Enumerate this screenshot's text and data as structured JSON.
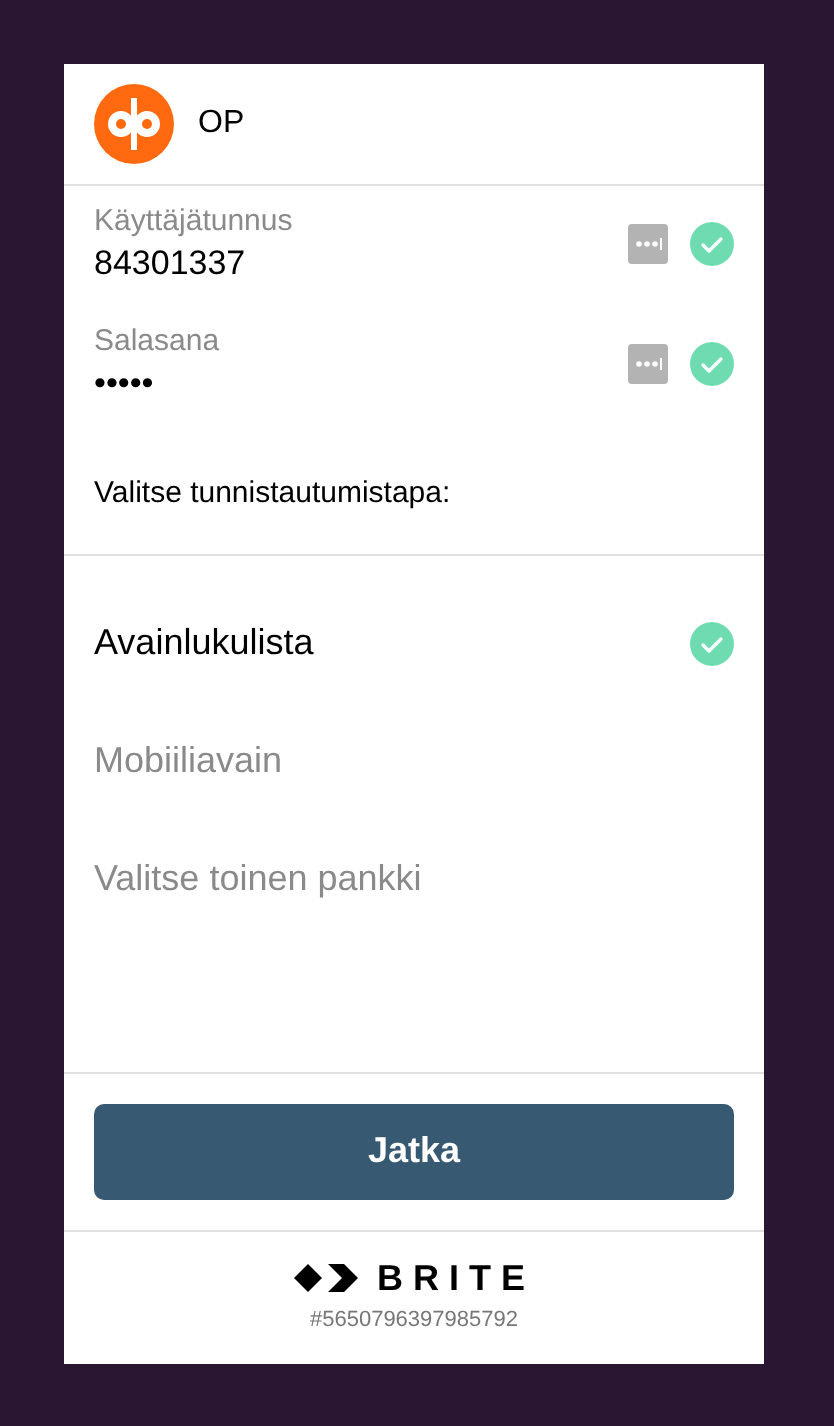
{
  "bank": {
    "name": "OP"
  },
  "fields": [
    {
      "label": "Käyttäjätunnus",
      "value": "84301337",
      "valid": true
    },
    {
      "label": "Salasana",
      "value": "•••••",
      "valid": true
    }
  ],
  "method_prompt": "Valitse tunnistautumistapa:",
  "methods": [
    {
      "label": "Avainlukulista",
      "selected": true
    },
    {
      "label": "Mobiiliavain",
      "selected": false
    },
    {
      "label": "Valitse toinen pankki",
      "selected": false
    }
  ],
  "continue_button": "Jatka",
  "footer": {
    "brand": "BRITE",
    "reference": "#5650796397985792"
  }
}
